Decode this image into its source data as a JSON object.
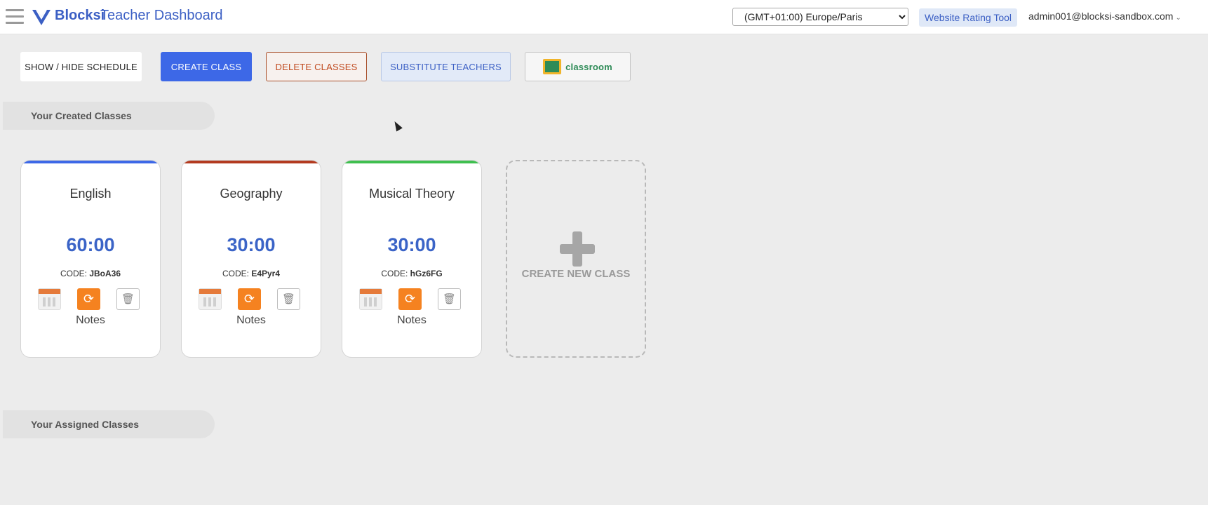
{
  "header": {
    "brand": "Blocksi",
    "title": "Teacher Dashboard",
    "timezone": "(GMT+01:00) Europe/Paris",
    "rating_tool": "Website Rating Tool",
    "user_email": "admin001@blocksi-sandbox.com"
  },
  "toolbar": {
    "show_hide_schedule": "SHOW / HIDE SCHEDULE",
    "create_class": "CREATE CLASS",
    "delete_classes": "DELETE CLASSES",
    "substitute_teachers": "SUBSTITUTE TEACHERS",
    "classroom": "classroom"
  },
  "sections": {
    "created": "Your Created Classes",
    "assigned": "Your Assigned Classes"
  },
  "classes": [
    {
      "name": "English",
      "timer": "60:00",
      "code_label": "CODE:",
      "code": "JBoA36",
      "notes": "Notes",
      "accent": "#3d68e7"
    },
    {
      "name": "Geography",
      "timer": "30:00",
      "code_label": "CODE:",
      "code": "E4Pyr4",
      "notes": "Notes",
      "accent": "#b33a1f"
    },
    {
      "name": "Musical Theory",
      "timer": "30:00",
      "code_label": "CODE:",
      "code": "hGz6FG",
      "notes": "Notes",
      "accent": "#3fbf4f"
    }
  ],
  "new_class": {
    "label": "CREATE NEW CLASS"
  },
  "colors": {
    "primary": "#3d68e7",
    "orange": "#f58220",
    "delete": "#c0491e"
  }
}
